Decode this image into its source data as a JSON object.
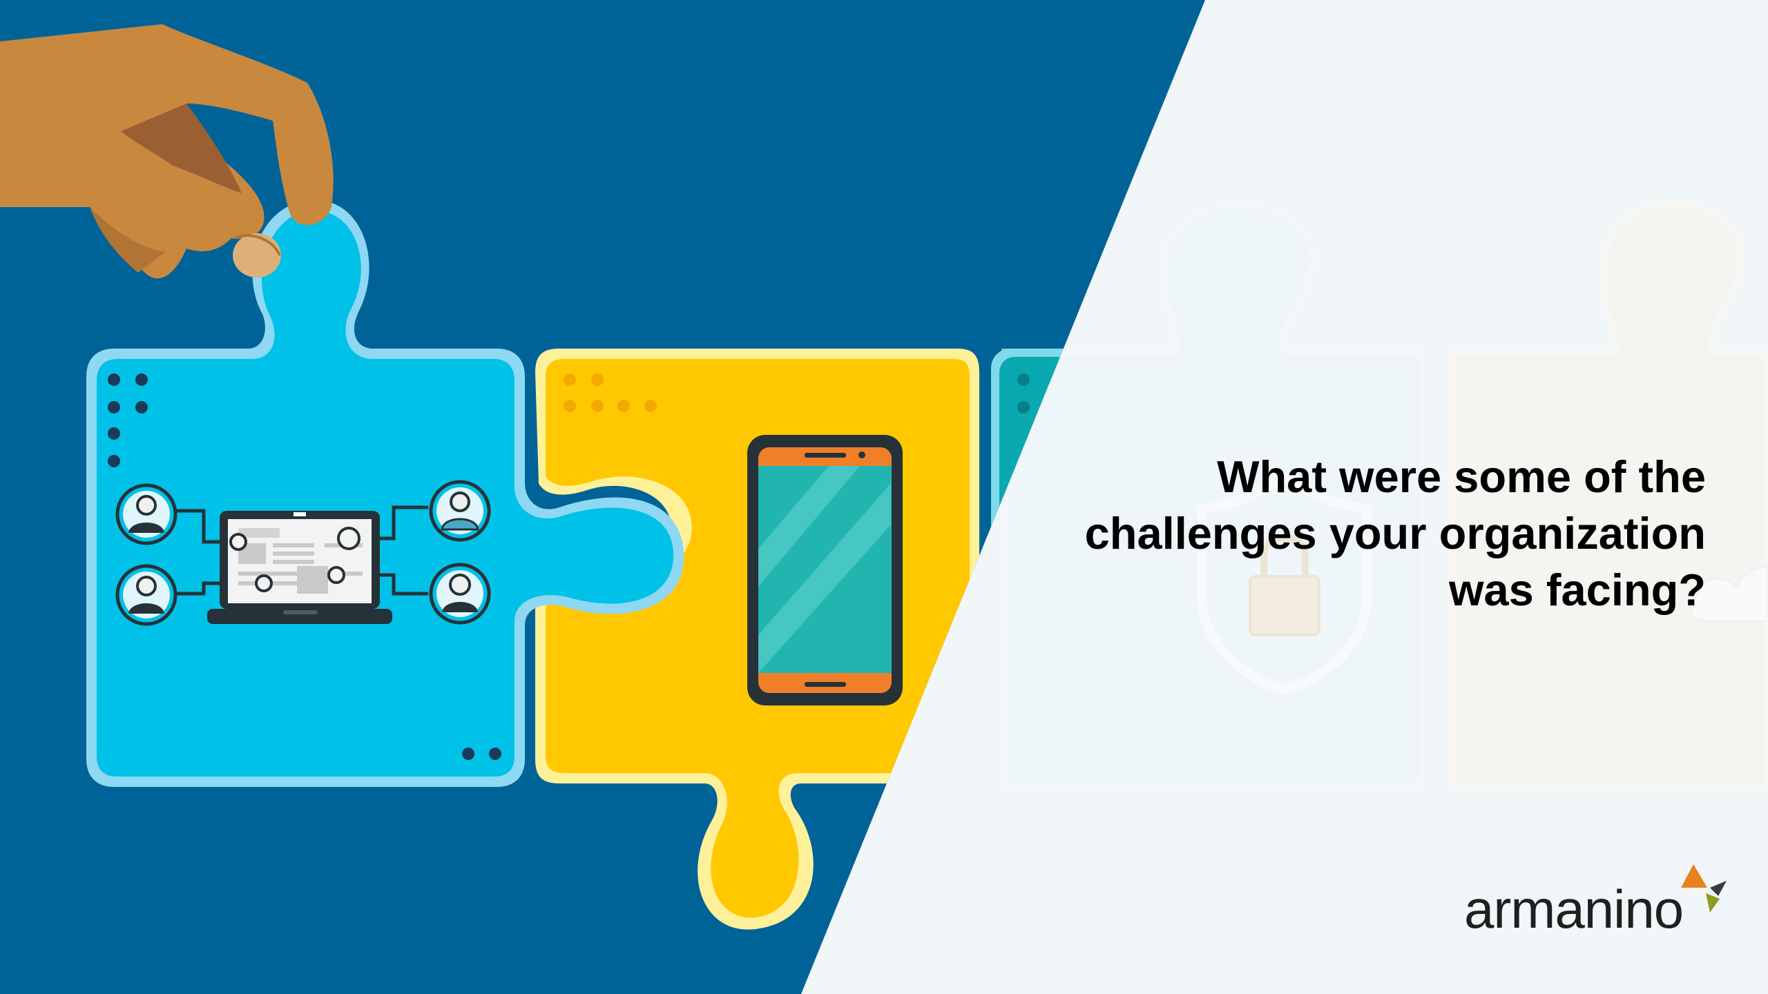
{
  "slide": {
    "question": "What were some of the\nchallenges your organization\nwas facing?",
    "brand": {
      "name": "armanino",
      "mark_colors": [
        "#e8821e",
        "#8f9b1f",
        "#3a3a3a"
      ]
    }
  },
  "colors": {
    "background_dark": "#006398",
    "background_light": "#f1f6f9",
    "puzzle_blue": "#00c1e8",
    "puzzle_yellow": "#ffc800",
    "puzzle_teal": "#0aa8b0",
    "hand": "#c8883e",
    "phone_screen": "#22b5b0",
    "phone_accent": "#f07f2a",
    "text": "#000000"
  },
  "illustration": {
    "hand": "hand-holding-puzzle-piece",
    "pieces": [
      "network-laptop-piece",
      "smartphone-piece",
      "lock-piece",
      "cloud-piece"
    ],
    "people_icons": [
      "person-icon",
      "person-icon",
      "person-icon",
      "person-icon"
    ]
  }
}
